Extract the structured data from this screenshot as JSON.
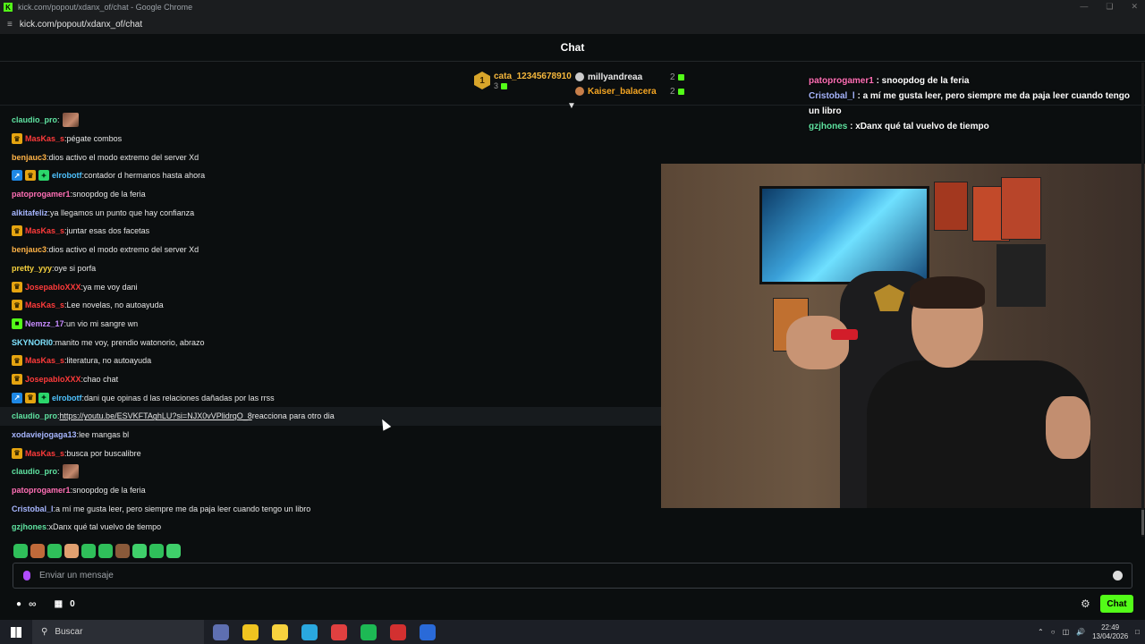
{
  "window": {
    "title": "kick.com/popout/xdanx_of/chat - Google Chrome",
    "url": "kick.com/popout/xdanx_of/chat"
  },
  "chat": {
    "header_title": "Chat",
    "input_placeholder": "Enviar un mensaje",
    "send_label": "Chat",
    "points_count": "0"
  },
  "pinned": {
    "top_gifter": {
      "rank": "1",
      "name": "cata_12345678910",
      "count": "3"
    },
    "gifters": [
      {
        "name": "millyandreaa",
        "count": "2"
      },
      {
        "name": "Kaiser_balacera",
        "count": "2"
      }
    ]
  },
  "overlay": [
    {
      "user": "patoprogamer1",
      "color": "#ff6fb5",
      "text": " : snoopdog de la feria"
    },
    {
      "user": "Cristobal_l",
      "color": "#a7b6ff",
      "text": " : a mí me gusta leer, pero siempre me da paja leer cuando tengo un libro"
    },
    {
      "user": "gzjhones",
      "color": "#5fe3a1",
      "text": " : xDanx qué tal vuelvo de tiempo"
    }
  ],
  "messages": [
    {
      "user": "claudio_pro",
      "color": "#5fe3a1",
      "badges": [],
      "text": "",
      "emote": true
    },
    {
      "user": "MasKas_s",
      "color": "#ff3b3b",
      "badges": [
        "crown"
      ],
      "text": "pégate combos"
    },
    {
      "user": "benjauc3",
      "color": "#ffb347",
      "badges": [],
      "text": "dios activo el modo extremo del server Xd"
    },
    {
      "user": "elrobotf",
      "color": "#4fc3ff",
      "badges": [
        "blue",
        "crown",
        "green"
      ],
      "text": "contador d hermanos hasta ahora"
    },
    {
      "user": "patoprogamer1",
      "color": "#ff6fb5",
      "badges": [],
      "text": "snoopdog de la feria"
    },
    {
      "user": "alkitafeliz",
      "color": "#a7b6ff",
      "badges": [],
      "text": "ya llegamos un punto que hay confianza"
    },
    {
      "user": "MasKas_s",
      "color": "#ff3b3b",
      "badges": [
        "crown"
      ],
      "text": "juntar esas dos facetas"
    },
    {
      "user": "benjauc3",
      "color": "#ffb347",
      "badges": [],
      "text": "dios activo el modo extremo del server Xd"
    },
    {
      "user": "pretty_yyy",
      "color": "#f7d23e",
      "badges": [],
      "text": "oye si porfa"
    },
    {
      "user": "JosepabloXXX",
      "color": "#ff3b3b",
      "badges": [
        "crown"
      ],
      "text": "ya me voy dani"
    },
    {
      "user": "MasKas_s",
      "color": "#ff3b3b",
      "badges": [
        "crown"
      ],
      "text": "Lee novelas, no autoayuda"
    },
    {
      "user": "Nemzz_17",
      "color": "#c78bff",
      "badges": [
        "bot"
      ],
      "text": "un vio mi sangre wn"
    },
    {
      "user": "SKYNORI0",
      "color": "#7fe3ff",
      "badges": [],
      "text": "manito me voy, prendio watonorio, abrazo"
    },
    {
      "user": "MasKas_s",
      "color": "#ff3b3b",
      "badges": [
        "crown"
      ],
      "text": "literatura, no autoayuda"
    },
    {
      "user": "JosepabloXXX",
      "color": "#ff3b3b",
      "badges": [
        "crown"
      ],
      "text": "chao chat"
    },
    {
      "user": "elrobotf",
      "color": "#4fc3ff",
      "badges": [
        "blue",
        "crown",
        "green"
      ],
      "text": "dani que opinas d las relaciones dañadas por las rrss"
    },
    {
      "user": "claudio_pro",
      "color": "#5fe3a1",
      "badges": [],
      "link": "https://youtu.be/ESVKFTAghLU?si=NJX0vVPlidrqO_8",
      "text": " reacciona para otro dia",
      "highlight": true
    },
    {
      "user": "xodaviejogaga13",
      "color": "#a7b6ff",
      "badges": [],
      "text": "lee mangas bl"
    },
    {
      "user": "MasKas_s",
      "color": "#ff3b3b",
      "badges": [
        "crown"
      ],
      "text": "busca por buscalibre"
    },
    {
      "user": "claudio_pro",
      "color": "#5fe3a1",
      "badges": [],
      "text": "",
      "emote": true
    },
    {
      "user": "patoprogamer1",
      "color": "#ff6fb5",
      "badges": [],
      "text": "snoopdog de la feria"
    },
    {
      "user": "Cristobal_l",
      "color": "#a7b6ff",
      "badges": [],
      "text": "a mí me gusta leer, pero siempre me da paja leer cuando tengo un libro"
    },
    {
      "user": "gzjhones",
      "color": "#5fe3a1",
      "badges": [],
      "text": "xDanx qué tal vuelvo de tiempo"
    }
  ],
  "emote_bar": [
    "#2fbf5a",
    "#c06a3a",
    "#2fbf5a",
    "#e0a070",
    "#2fbf5a",
    "#2fbf5a",
    "#8a5a3a",
    "#3fcf6a",
    "#2fbf5a",
    "#3fcf6a"
  ],
  "taskbar": {
    "search_label": "Buscar",
    "time": "22:49",
    "date": "13/04/2026",
    "apps": [
      "#5e6fb0",
      "#f0c420",
      "#f7d23e",
      "#2aa8e0",
      "#e04040",
      "#1db954",
      "#d23030",
      "#2a6ad8"
    ]
  },
  "colors": {
    "accent": "#53fc18",
    "background": "#0b0e0f"
  }
}
